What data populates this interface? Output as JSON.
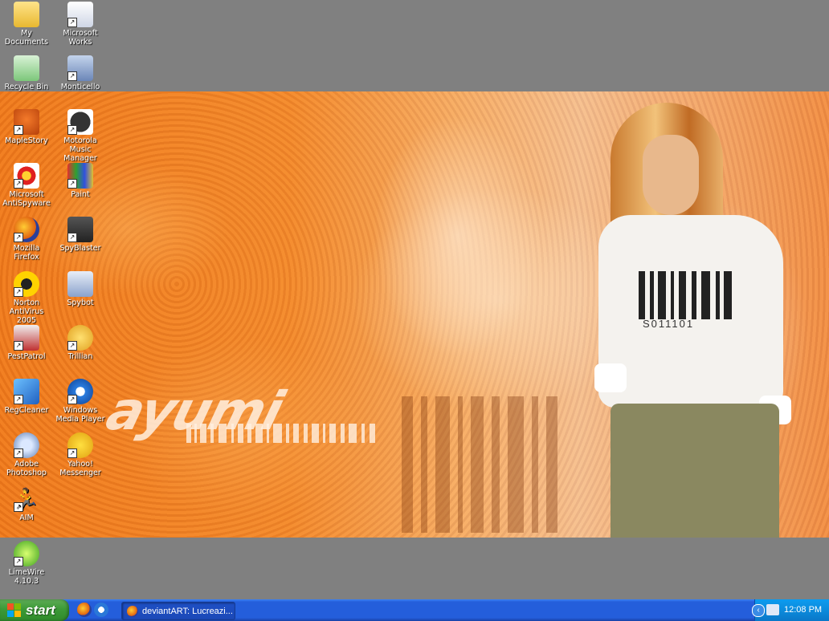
{
  "desktop": {
    "icons": [
      {
        "label": "My Documents",
        "icon": "folder-documents-icon"
      },
      {
        "label": "Microsoft Works",
        "icon": "works-icon"
      },
      {
        "label": "Recycle Bin",
        "icon": "recycle-bin-icon"
      },
      {
        "label": "Monticello",
        "icon": "monticello-icon"
      },
      {
        "label": "MapleStory",
        "icon": "maplestory-icon"
      },
      {
        "label": "Motorola Music Manager",
        "icon": "motorola-icon"
      },
      {
        "label": "Microsoft AntiSpyware",
        "icon": "antispyware-icon"
      },
      {
        "label": "Paint",
        "icon": "paint-icon"
      },
      {
        "label": "Mozilla Firefox",
        "icon": "firefox-icon"
      },
      {
        "label": "SpyBlaster",
        "icon": "spyblaster-icon"
      },
      {
        "label": "Norton AntiVirus 2005",
        "icon": "norton-icon"
      },
      {
        "label": "Spybot",
        "icon": "spybot-icon"
      },
      {
        "label": "PestPatrol",
        "icon": "pestpatrol-icon"
      },
      {
        "label": "Trillian",
        "icon": "trillian-icon"
      },
      {
        "label": "RegCleaner",
        "icon": "regcleaner-icon"
      },
      {
        "label": "Windows Media Player",
        "icon": "media-player-icon"
      },
      {
        "label": "Adobe Photoshop",
        "icon": "photoshop-icon"
      },
      {
        "label": "Yahoo! Messenger",
        "icon": "yahoo-messenger-icon"
      },
      {
        "label": "AIM",
        "icon": "aim-icon"
      },
      {
        "label": "LimeWire 4.10.3",
        "icon": "limewire-icon"
      }
    ],
    "wallpaper": {
      "logo_text": "ayumi",
      "shirt_text": "S011101"
    }
  },
  "taskbar": {
    "start_label": "start",
    "quick_launch": [
      "firefox-icon",
      "ie-icon"
    ],
    "tasks": [
      {
        "label": "deviantART: Lucreazi...",
        "icon": "firefox-icon"
      }
    ],
    "tray": {
      "clock": "12:08 PM",
      "expand_glyph": "‹"
    }
  },
  "colors": {
    "taskbar_blue": "#245edb",
    "start_green": "#3c9a37",
    "tray_blue": "#0b8bdc",
    "desktop_gray": "#808080",
    "wallpaper_orange": "#f07a1c"
  }
}
